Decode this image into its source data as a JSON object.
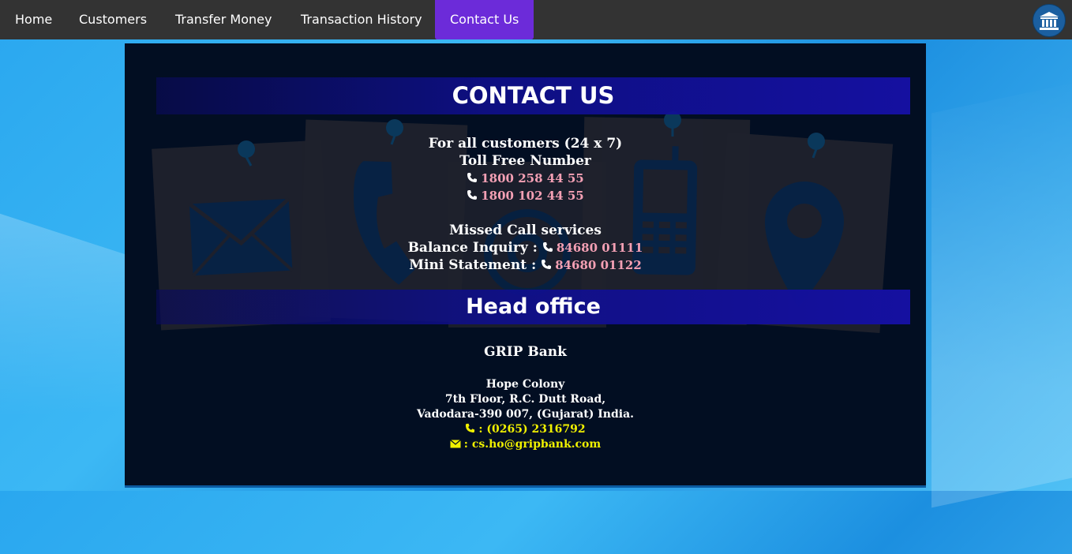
{
  "nav": {
    "items": [
      "Home",
      "Customers",
      "Transfer Money",
      "Transaction History",
      "Contact Us"
    ],
    "active": "Contact Us",
    "logo_icon": "bank-icon"
  },
  "contact": {
    "title": "CONTACT US",
    "all_customers": "For all customers (24 x 7)",
    "toll_free_label": "Toll Free Number",
    "toll_free_1": "1800 258 44 55",
    "toll_free_2": "1800 102 44 55",
    "missed_call_label": "Missed Call services",
    "balance_label": "Balance Inquiry :",
    "balance_number": "84680 01111",
    "mini_label": "Mini Statement :",
    "mini_number": "84680 01122"
  },
  "head_office": {
    "title": "Head office",
    "bank_name": "GRIP Bank",
    "address_1": "Hope Colony",
    "address_2": "7th Floor, R.C. Dutt Road,",
    "address_3": "Vadodara-390 007, (Gujarat) India.",
    "phone": ": (0265) 2316792",
    "email": ": cs.ho@gripbank.com"
  },
  "colors": {
    "navbar": "#333333",
    "active_tab": "#6c2bd9",
    "panel": "#020f22",
    "phone_text": "#f4a0b4",
    "office_contact_text": "#f0f000"
  }
}
